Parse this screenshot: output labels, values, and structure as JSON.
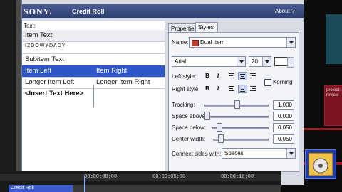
{
  "window": {
    "brand": "SONY.",
    "title": "Credit Roll",
    "about": "About ?"
  },
  "left_panel": {
    "text_label": "Text:",
    "rows": [
      {
        "c1": "Item Text",
        "c2": ""
      },
      {
        "c1": "IZDOWYDADY",
        "c2": ""
      },
      {
        "c1": "Subitem Text",
        "c2": ""
      },
      {
        "c1": "Item Left",
        "c2": "Item Right"
      },
      {
        "c1": "Longer Item Left",
        "c2": "Longer Item Right"
      },
      {
        "c1": "<Insert Text Here>",
        "c2": ""
      }
    ]
  },
  "tabs": [
    "Properties",
    "Styles"
  ],
  "styles": {
    "name_label": "Name:",
    "name_value": "Dual Item",
    "font_value": "Arial",
    "size_value": "20",
    "left_style_label": "Left style:",
    "right_style_label": "Right style:",
    "bold": "B",
    "italic": "I",
    "kerning_label": "Kerning",
    "tracking_label": "Tracking:",
    "tracking_value": "1.000",
    "space_above_label": "Space above:",
    "space_above_value": "0.000",
    "space_below_label": "Space below:",
    "space_below_value": "0.050",
    "center_width_label": "Center width:",
    "center_width_value": "0.050",
    "connect_label": "Connect sides with:",
    "connect_value": "Spaces",
    "tracking_level": 0.5,
    "space_above_level": 0.0,
    "space_below_level": 0.1,
    "center_width_level": 0.1
  },
  "timeline": {
    "tc1": "00:00:00;00",
    "tc2": "00:00:05;00",
    "tc3": "00:00:10;00",
    "clip_label": "Credit Roll"
  },
  "host_right": {
    "panel_text": "project:\nreview"
  },
  "colors": {
    "titlebar": "#2e3f70",
    "selection": "#2f56c8",
    "clip": "#3a5bd0"
  }
}
